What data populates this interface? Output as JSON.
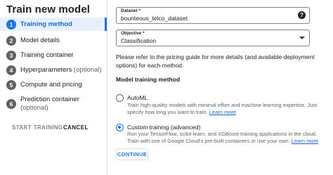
{
  "sidebar": {
    "title": "Train new model",
    "steps": [
      {
        "number": "1",
        "label": "Training method",
        "optional": ""
      },
      {
        "number": "2",
        "label": "Model details",
        "optional": ""
      },
      {
        "number": "3",
        "label": "Training container",
        "optional": ""
      },
      {
        "number": "4",
        "label": "Hyperparameters",
        "optional": "(optional)"
      },
      {
        "number": "5",
        "label": "Compute and pricing",
        "optional": ""
      },
      {
        "number": "6",
        "label": "Prediction container",
        "optional": "(optional)"
      }
    ],
    "start_training_label": "START TRAINING",
    "cancel_label": "CANCEL"
  },
  "main": {
    "dataset": {
      "label": "Dataset *",
      "value": "bounteous_telco_dataset"
    },
    "objective": {
      "label": "Objective *",
      "value": "Classification"
    },
    "pricing_text": "Please refer to the pricing guide for more details (and available deployment options) for each method.",
    "section_title": "Model training method",
    "options": [
      {
        "title": "AutoML",
        "description": "Train high-quality models with minimal effort and machine learning expertise. Just specify how long you want to train.",
        "link": "Learn more",
        "selected": false
      },
      {
        "title": "Custom training (advanced)",
        "description": "Run your TensorFlow, scikit-learn, and XGBoost training applications in the cloud. Train with one of Google Cloud's pre-built containers or use your own.",
        "link": "Learn more",
        "selected": true
      }
    ],
    "continue_label": "CONTINUE"
  },
  "icons": {
    "help": "help-circle-icon",
    "dropdown": "caret-down-icon"
  },
  "colors": {
    "accent": "#1a73e8",
    "active_bg": "#e8f0fe",
    "step_inactive": "#5f6368"
  }
}
